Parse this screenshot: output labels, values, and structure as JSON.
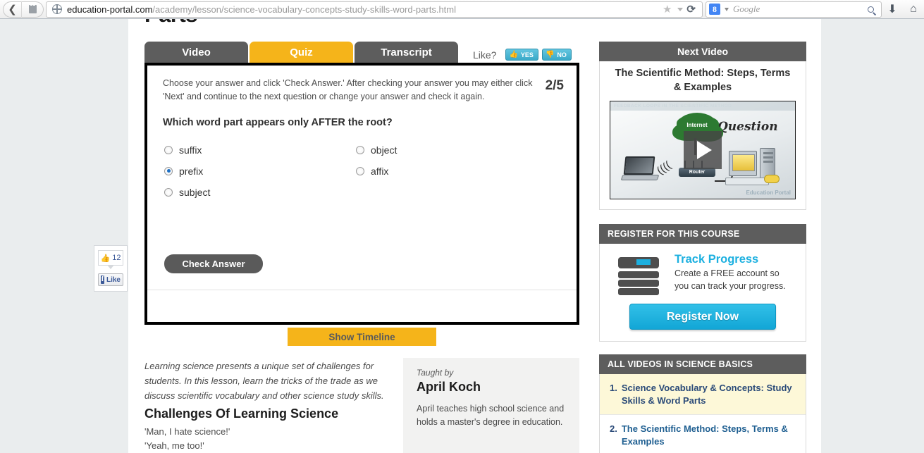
{
  "browser": {
    "back_icon": "back-arrow-icon",
    "site_icon": "page-icon",
    "url_domain": "education-portal.com",
    "url_path": "/academy/lesson/science-vocabulary-concepts-study-skills-word-parts.html",
    "star_icon": "★",
    "reload_icon": "⟳",
    "search_engine": "Google",
    "search_engine_badge": "8",
    "download_icon": "⬇",
    "home_icon": "⌂"
  },
  "page": {
    "title_cropped": "Parts"
  },
  "tabs": [
    {
      "label": "Video",
      "active": false
    },
    {
      "label": "Quiz",
      "active": true
    },
    {
      "label": "Transcript",
      "active": false
    }
  ],
  "like": {
    "prompt": "Like?",
    "yes_label": "YES",
    "no_label": "NO",
    "thumb_up": "👍",
    "thumb_down": "👎"
  },
  "quiz": {
    "instructions": "Choose your answer and click 'Check Answer.' After checking your answer you may either click 'Next' and continue to the next question or change your answer and check it again.",
    "progress": "2/5",
    "question": "Which word part appears only AFTER the root?",
    "options": [
      {
        "label": "suffix",
        "selected": false
      },
      {
        "label": "object",
        "selected": false
      },
      {
        "label": "prefix",
        "selected": true
      },
      {
        "label": "affix",
        "selected": false
      },
      {
        "label": "subject",
        "selected": false
      }
    ],
    "check_answer_label": "Check Answer"
  },
  "timeline": {
    "show_label": "Show Timeline"
  },
  "lesson": {
    "summary": "Learning science presents a unique set of challenges for students. In this lesson, learn the tricks of the trade as we discuss scientific vocabulary and other science study skills.",
    "heading": "Challenges Of Learning Science",
    "line_1": "'Man, I hate science!'",
    "line_2": "'Yeah, me too!'"
  },
  "instructor": {
    "taught_by_label": "Taught by",
    "name": "April Koch",
    "bio": "April teaches high school science and holds a master's degree in education."
  },
  "sidebar": {
    "next_video": {
      "header": "Next Video",
      "title": "The Scientific Method: Steps, Terms & Examples",
      "thumbnail": {
        "caption": "FEEDBACK LOOPS IN THE SCIENTIFIC METHOD",
        "question_word": "Question",
        "cloud_label": "Internet",
        "router_label": "Router",
        "brand": "Education Portal",
        "play_icon": "play-icon"
      }
    },
    "register": {
      "header": "REGISTER FOR THIS COURSE",
      "title": "Track Progress",
      "description": "Create a FREE account so you can track your progress.",
      "button_label": "Register Now",
      "icon": "books-icon"
    },
    "all_videos": {
      "header": "ALL VIDEOS IN SCIENCE BASICS",
      "items": [
        {
          "index": "1.",
          "title": "Science Vocabulary & Concepts: Study Skills & Word Parts",
          "current": true
        },
        {
          "index": "2.",
          "title": "The Scientific Method: Steps, Terms & Examples",
          "current": false
        }
      ]
    }
  },
  "facebook": {
    "count": "12",
    "thumb_icon": "👍",
    "logo_letter": "f",
    "like_label": "Like"
  },
  "colors": {
    "tab_inactive": "#5d5d5d",
    "tab_active": "#f5b41a",
    "accent_blue": "#1cb0e0",
    "panel_header": "#5d5d5d",
    "page_bg": "#eaedee",
    "link_blue": "#1f5f91",
    "highlight_row": "#fdf8d8"
  }
}
